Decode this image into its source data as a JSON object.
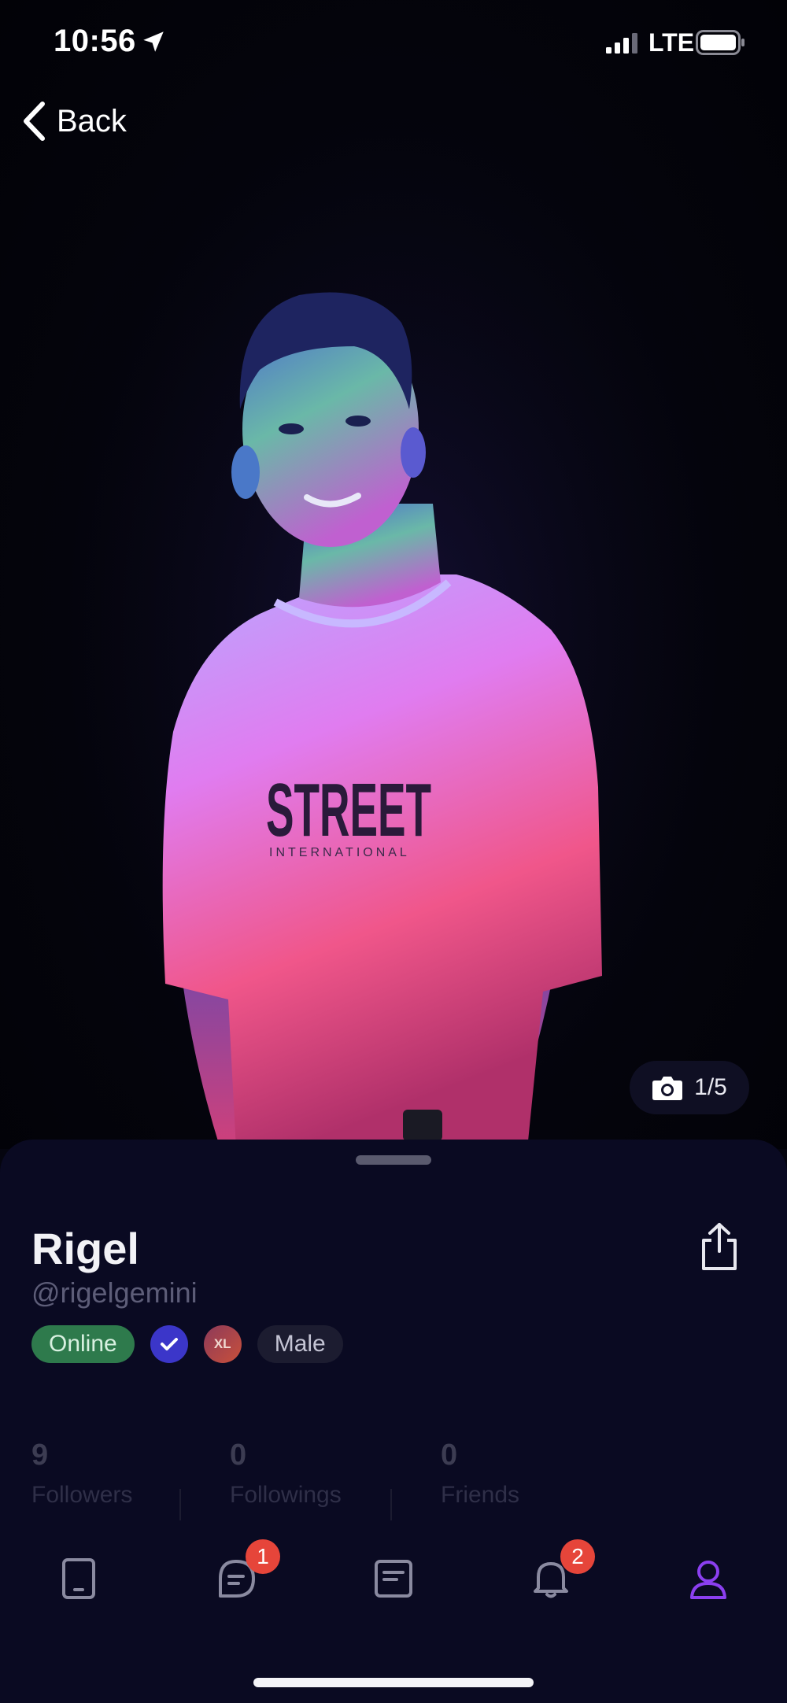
{
  "status_bar": {
    "time": "10:56",
    "network": "LTE"
  },
  "nav": {
    "back_label": "Back"
  },
  "photo": {
    "counter": "1/5",
    "shirt_text": "STREET",
    "shirt_subtext": "INTERNATIONAL"
  },
  "profile": {
    "name": "Rigel",
    "handle": "@rigelgemini",
    "badges": {
      "status": "Online",
      "size": "XL",
      "gender": "Male"
    }
  },
  "stats": [
    {
      "value": "9",
      "label": "Followers"
    },
    {
      "value": "0",
      "label": "Followings"
    },
    {
      "value": "0",
      "label": "Friends"
    }
  ],
  "tabs": [
    {
      "icon": "tablet-icon",
      "badge": ""
    },
    {
      "icon": "chat-icon",
      "badge": "1"
    },
    {
      "icon": "document-icon",
      "badge": ""
    },
    {
      "icon": "bell-icon",
      "badge": "2"
    },
    {
      "icon": "profile-icon",
      "badge": ""
    }
  ],
  "colors": {
    "accent": "#8b3ff0",
    "online": "#2e7a4c",
    "verified": "#3b36c9",
    "notification": "#e6453a",
    "background": "#0a0a22"
  }
}
